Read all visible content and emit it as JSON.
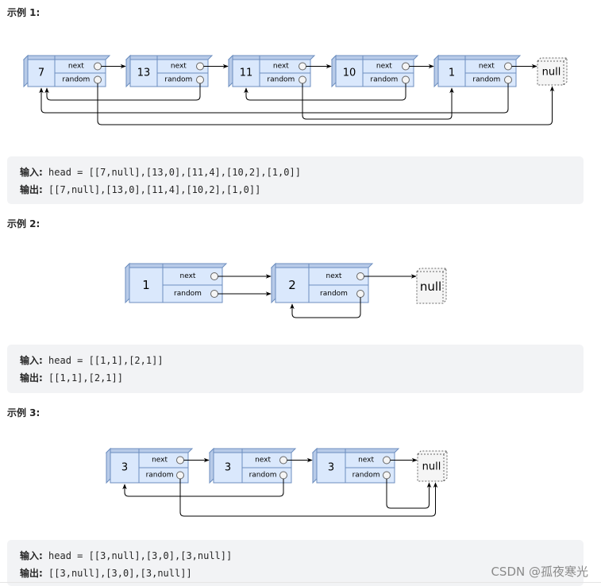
{
  "examples": [
    {
      "title": "示例 1:",
      "input_label": "输入:",
      "input_value": "head = [[7,null],[13,0],[11,4],[10,2],[1,0]]",
      "output_label": "输出:",
      "output_value": "[[7,null],[13,0],[11,4],[10,2],[1,0]]",
      "diagram": {
        "nodes": [
          {
            "val": "7",
            "random": null
          },
          {
            "val": "13",
            "random": 0
          },
          {
            "val": "11",
            "random": 4
          },
          {
            "val": "10",
            "random": 2
          },
          {
            "val": "1",
            "random": 0
          }
        ],
        "next_label": "next",
        "random_label": "random",
        "null_label": "null"
      }
    },
    {
      "title": "示例 2:",
      "input_label": "输入:",
      "input_value": "head = [[1,1],[2,1]]",
      "output_label": "输出:",
      "output_value": "[[1,1],[2,1]]",
      "diagram": {
        "nodes": [
          {
            "val": "1",
            "random": 1
          },
          {
            "val": "2",
            "random": 1
          }
        ],
        "next_label": "next",
        "random_label": "random",
        "null_label": "null"
      }
    },
    {
      "title": "示例 3:",
      "input_label": "输入:",
      "input_value": "head = [[3,null],[3,0],[3,null]]",
      "output_label": "输出:",
      "output_value": "[[3,null],[3,0],[3,null]]",
      "diagram": {
        "nodes": [
          {
            "val": "3",
            "random": null
          },
          {
            "val": "3",
            "random": 0
          },
          {
            "val": "3",
            "random": null
          }
        ],
        "next_label": "next",
        "random_label": "random",
        "null_label": "null"
      }
    }
  ],
  "watermark": "CSDN @孤夜寒光",
  "colors": {
    "node_fill": "#dae8fc",
    "node_stroke": "#6c8ebf",
    "node_side": "#b8cbe8",
    "null_fill": "#f5f5f5",
    "null_stroke": "#666666",
    "code_bg": "#f2f3f5"
  }
}
